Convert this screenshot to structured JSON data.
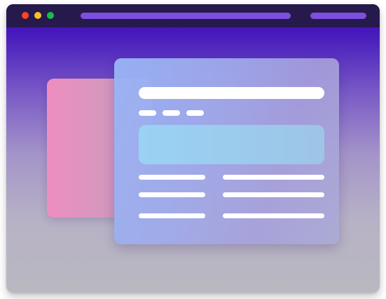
{
  "window": {
    "controls": [
      "close",
      "minimize",
      "maximize"
    ],
    "colors": {
      "titlebar": "#261a4c",
      "close": "#f9471d",
      "minimize": "#f7c026",
      "maximize": "#14c04a",
      "address_bar": "#7d4fe0",
      "gradient_top": "#3a00b4",
      "gradient_bottom": "#b9b8c0"
    }
  },
  "cards": {
    "back_card_color": "#ee8ec0",
    "front_card_color": "#98b4f6",
    "banner_color": "#9ad2f4",
    "placeholder_color": "#ffffff"
  }
}
